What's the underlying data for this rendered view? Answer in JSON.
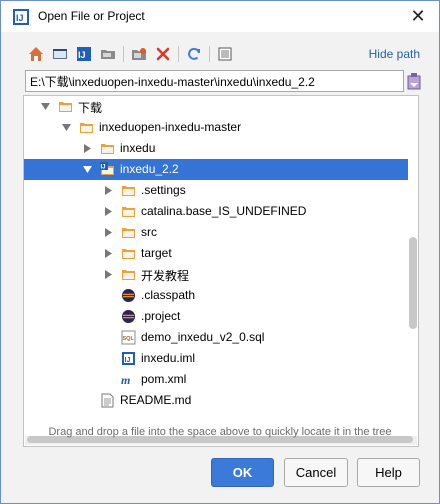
{
  "window": {
    "title": "Open File or Project",
    "close_glyph": "✕",
    "title_icon": "intellij-idea-icon"
  },
  "toolbar": {
    "buttons": [
      {
        "name": "home-icon"
      },
      {
        "name": "desktop-icon"
      },
      {
        "name": "project-icon"
      },
      {
        "name": "new-folder-icon"
      },
      {
        "name": "new-module-icon"
      },
      {
        "name": "delete-icon"
      },
      {
        "name": "refresh-icon"
      },
      {
        "name": "show-hidden-icon"
      }
    ],
    "hide_path_label": "Hide path"
  },
  "path": {
    "value": "E:\\下载\\inxeduopen-inxedu-master\\inxedu\\inxedu_2.2"
  },
  "tree": {
    "items": [
      {
        "label": "下载",
        "type": "folder",
        "expanded": true
      },
      {
        "label": "inxeduopen-inxedu-master",
        "type": "folder",
        "expanded": true
      },
      {
        "label": "inxedu",
        "type": "folder",
        "expanded": false
      },
      {
        "label": "inxedu_2.2",
        "type": "project-folder",
        "expanded": true,
        "selected": true
      },
      {
        "label": ".settings",
        "type": "folder",
        "expanded": false
      },
      {
        "label": "catalina.base_IS_UNDEFINED",
        "type": "folder",
        "expanded": false
      },
      {
        "label": "src",
        "type": "folder",
        "expanded": false
      },
      {
        "label": "target",
        "type": "folder",
        "expanded": false
      },
      {
        "label": "开发教程",
        "type": "folder",
        "expanded": false
      },
      {
        "label": ".classpath",
        "type": "eclipse-file"
      },
      {
        "label": ".project",
        "type": "eclipse-file"
      },
      {
        "label": "demo_inxedu_v2_0.sql",
        "type": "sql-file"
      },
      {
        "label": "inxedu.iml",
        "type": "iml-file"
      },
      {
        "label": "pom.xml",
        "type": "maven-file"
      },
      {
        "label": "README.md",
        "type": "text-file"
      }
    ]
  },
  "hint": "Drag and drop a file into the space above to quickly locate it in the tree",
  "buttons": {
    "ok": "OK",
    "cancel": "Cancel",
    "help": "Help"
  },
  "colors": {
    "accent": "#3574d4",
    "link": "#2563a6",
    "folder": "#e8a33d"
  }
}
